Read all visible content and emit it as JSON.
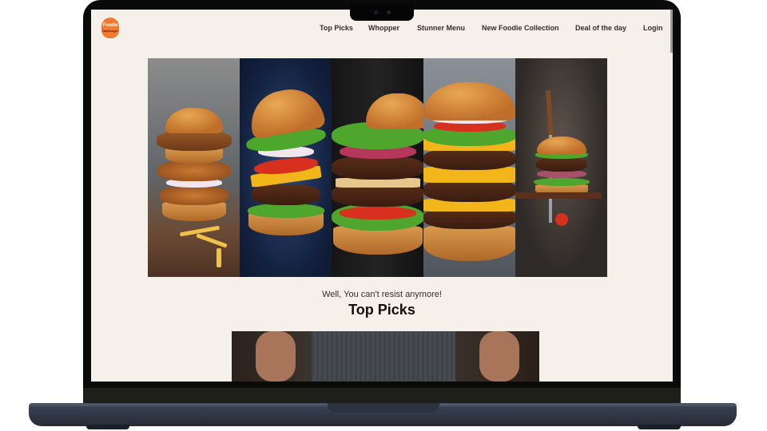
{
  "brand": {
    "name_line1": "Foodie",
    "name_line2": "Hamburger",
    "accent_color": "#ef7a30"
  },
  "nav": {
    "items": [
      {
        "label": "Top Picks"
      },
      {
        "label": "Whopper"
      },
      {
        "label": "Stunner Menu"
      },
      {
        "label": "New Foodie Collection"
      },
      {
        "label": "Deal of the day"
      },
      {
        "label": "Login"
      }
    ]
  },
  "hero": {
    "panels": [
      {
        "image": "stacked-crispy-chicken-burger-with-fries"
      },
      {
        "image": "floating-burger-ingredients"
      },
      {
        "image": "double-patty-lettuce-burger"
      },
      {
        "image": "double-cheese-burger"
      },
      {
        "image": "burger-on-knife-with-tomato"
      }
    ]
  },
  "section": {
    "tagline": "Well, You can't resist anymore!",
    "title": "Top Picks"
  },
  "preview": {
    "image": "chef-in-apron"
  },
  "colors": {
    "page_background": "#f6f0ea",
    "nav_text": "#3b2a26",
    "title_text": "#151010"
  }
}
